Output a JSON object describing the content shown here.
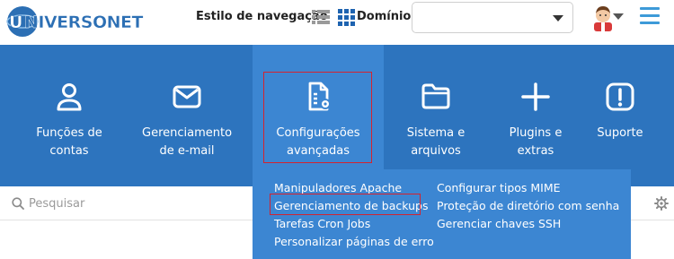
{
  "header": {
    "logo_text": "UNIVERSONET",
    "nav_style_label": "Estilo de navegação",
    "domain_label": "Domínio",
    "domain_value": ""
  },
  "menu": {
    "items": [
      {
        "label_line1": "Funções de",
        "label_line2": "contas",
        "icon": "user-icon"
      },
      {
        "label_line1": "Gerenciamento",
        "label_line2": "de e-mail",
        "icon": "envelope-icon"
      },
      {
        "label_line1": "Configurações",
        "label_line2": "avançadas",
        "icon": "document-gear-icon"
      },
      {
        "label_line1": "Sistema e",
        "label_line2": "arquivos",
        "icon": "folder-icon"
      },
      {
        "label_line1": "Plugins e",
        "label_line2": "extras",
        "icon": "plus-icon"
      },
      {
        "label_line1": "Suporte",
        "label_line2": "",
        "icon": "alert-icon"
      }
    ]
  },
  "dropdown": {
    "col1": [
      "Manipuladores Apache",
      "Gerenciamento de backups",
      "Tarefas Cron Jobs",
      "Personalizar páginas de erro"
    ],
    "col2": [
      "Configurar tipos MIME",
      "Proteção de diretório com senha",
      "Gerenciar chaves SSH"
    ]
  },
  "search": {
    "placeholder": "Pesquisar"
  },
  "colors": {
    "menu_bg": "#2d74be",
    "active_bg": "#3c86d2",
    "highlight": "#d4232f",
    "accent": "#3d9ad8"
  }
}
